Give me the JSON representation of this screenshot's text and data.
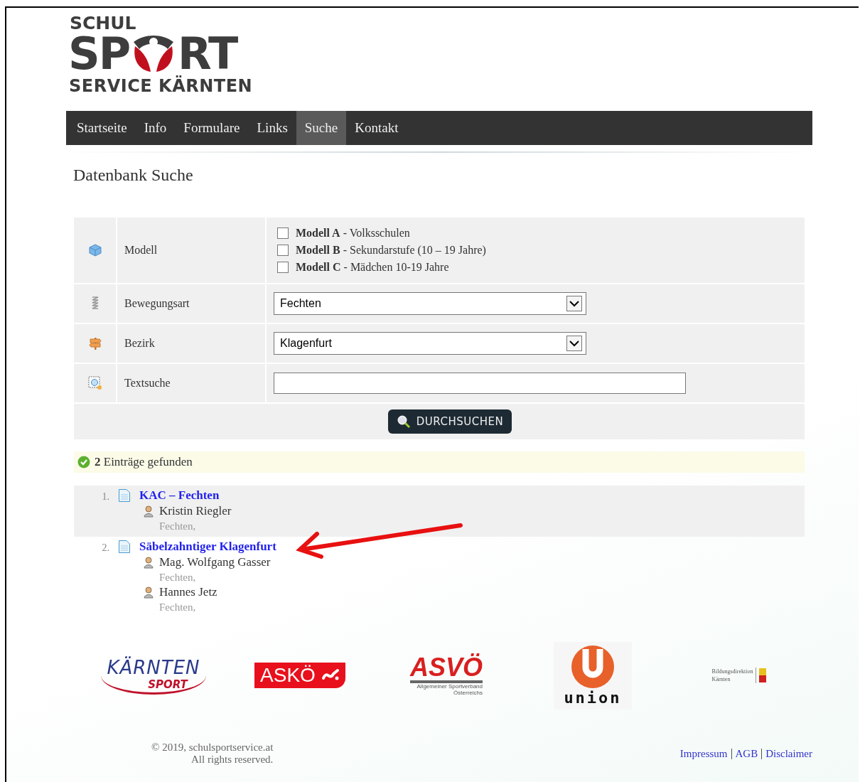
{
  "logo": {
    "line1": "SCHUL",
    "left": "SP",
    "right": "RT",
    "line3": "SERVICE KÄRNTEN"
  },
  "nav": [
    {
      "label": "Startseite",
      "selected": false
    },
    {
      "label": "Info",
      "selected": false
    },
    {
      "label": "Formulare",
      "selected": false
    },
    {
      "label": "Links",
      "selected": false
    },
    {
      "label": "Suche",
      "selected": true
    },
    {
      "label": "Kontakt",
      "selected": false
    }
  ],
  "heading": "Datenbank Suche",
  "form": {
    "rows": [
      {
        "kind": "checkboxes",
        "label": "Modell",
        "options": [
          {
            "text": "**Modell A** - Volksschulen",
            "checked": false
          },
          {
            "text": "**Modell B** - Sekundarstufe (10 – 19 Jahre)",
            "checked": false
          },
          {
            "text": "**Modell C** - Mädchen 10-19 Jahre",
            "checked": false
          }
        ]
      },
      {
        "kind": "select",
        "label": "Bewegungsart",
        "value": "Fechten"
      },
      {
        "kind": "select",
        "label": "Bezirk",
        "value": "Klagenfurt"
      },
      {
        "kind": "text",
        "label": "Textsuche"
      }
    ],
    "button": "DURCHSUCHEN"
  },
  "result_message": "**2** Einträge gefunden",
  "results": [
    {
      "number": "1.",
      "title": "KAC – Fechten",
      "shaded": true,
      "people": [
        {
          "name": "Kristin Riegler",
          "tags": "Fechten,"
        }
      ]
    },
    {
      "number": "2.",
      "title": "Säbelzahntiger Klagenfurt",
      "shaded": false,
      "people": [
        {
          "name": "Mag. Wolfgang Gasser",
          "tags": "Fechten,"
        },
        {
          "name": "Hannes Jetz",
          "tags": "Fechten,"
        }
      ]
    }
  ],
  "sponsors": [
    {
      "kind": "kaernten",
      "texts": [
        "KÄRNTEN",
        "SPORT"
      ]
    },
    {
      "kind": "askoe",
      "texts": [
        "ASKÖ"
      ]
    },
    {
      "kind": "asvoe",
      "texts": [
        "ASVÖ",
        "Allgemeiner Sportverband Österreichs"
      ]
    },
    {
      "kind": "union",
      "texts": [
        "union"
      ]
    },
    {
      "kind": "bildung",
      "texts": [
        "Bildungsdirektion",
        "Kärnten"
      ]
    }
  ],
  "footer": {
    "copyright": "© 2019, schulsportservice.at",
    "rights": "All rights reserved.",
    "links": [
      "Impressum",
      "AGB",
      "Disclaimer"
    ]
  }
}
